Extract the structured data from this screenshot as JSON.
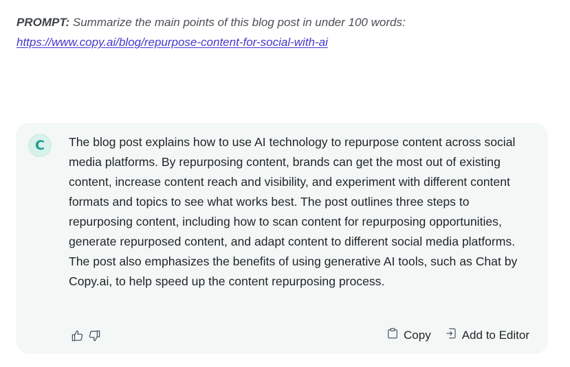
{
  "prompt": {
    "label": "PROMPT:",
    "text": "Summarize the main points of this blog post in under 100 words:",
    "link": "https://www.copy.ai/blog/repurpose-content-for-social-with-ai"
  },
  "response": {
    "avatar_letter": "C",
    "text": "The blog post explains how to use AI technology to repurpose content across social media platforms. By repurposing content, brands can get the most out of existing content, increase content reach and visibility, and experiment with different content formats and topics to see what works best. The post outlines three steps to repurposing content, including how to scan content for repurposing opportunities, generate repurposed content, and adapt content to different social media platforms. The post also emphasizes the benefits of using generative AI tools, such as Chat by Copy.ai, to help speed up the content repurposing process.",
    "actions": {
      "copy_label": "Copy",
      "add_to_editor_label": "Add to Editor"
    }
  },
  "icons": {
    "thumbs_up": "thumbs-up-icon",
    "thumbs_down": "thumbs-down-icon",
    "copy": "clipboard-icon",
    "add_to_editor": "add-to-editor-icon"
  },
  "colors": {
    "link": "#4338ca",
    "card_background": "#f3f8f7",
    "avatar_accent": "#1d9f8c",
    "avatar_background": "#d8f1ea"
  }
}
